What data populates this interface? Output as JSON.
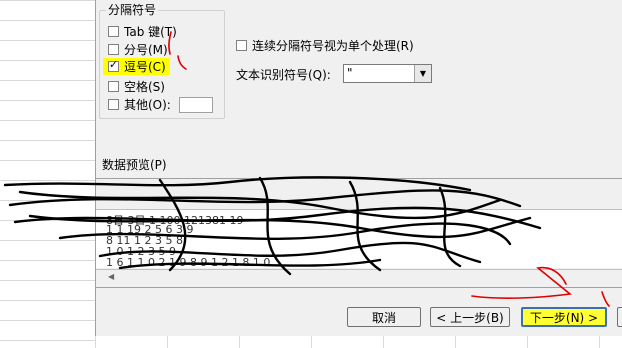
{
  "delimiters": {
    "title": "分隔符号",
    "options": [
      {
        "label": "Tab 键(T)",
        "checked": false,
        "highlighted": false
      },
      {
        "label": "分号(M)",
        "checked": false,
        "highlighted": false
      },
      {
        "label": "逗号(C)",
        "checked": true,
        "highlighted": true
      },
      {
        "label": "空格(S)",
        "checked": false,
        "highlighted": false
      },
      {
        "label": "其他(O):",
        "checked": false,
        "highlighted": false
      }
    ],
    "other_value": ""
  },
  "consecutive": {
    "label": "连续分隔符号视为单个处理(R)",
    "checked": false
  },
  "qualifier": {
    "label": "文本识别符号(Q):",
    "value": "\""
  },
  "preview": {
    "label": "数据预览(P)",
    "lines": [
      "8日 3日 1 100 121381 19",
      "1 1 19 2 5 6 3 9",
      "8 11 1 2 3 5 8",
      "1 0 1 2 3 5 9",
      "1 6 1 1 0 2 1 9 8 9 1 2 1 8 1 0"
    ]
  },
  "buttons": {
    "cancel": "取消",
    "back": "< 上一步(B)",
    "next": "下一步(N) >"
  },
  "colors": {
    "highlight": "#ffff00",
    "ink": "#000000",
    "annot": "#e00000"
  }
}
